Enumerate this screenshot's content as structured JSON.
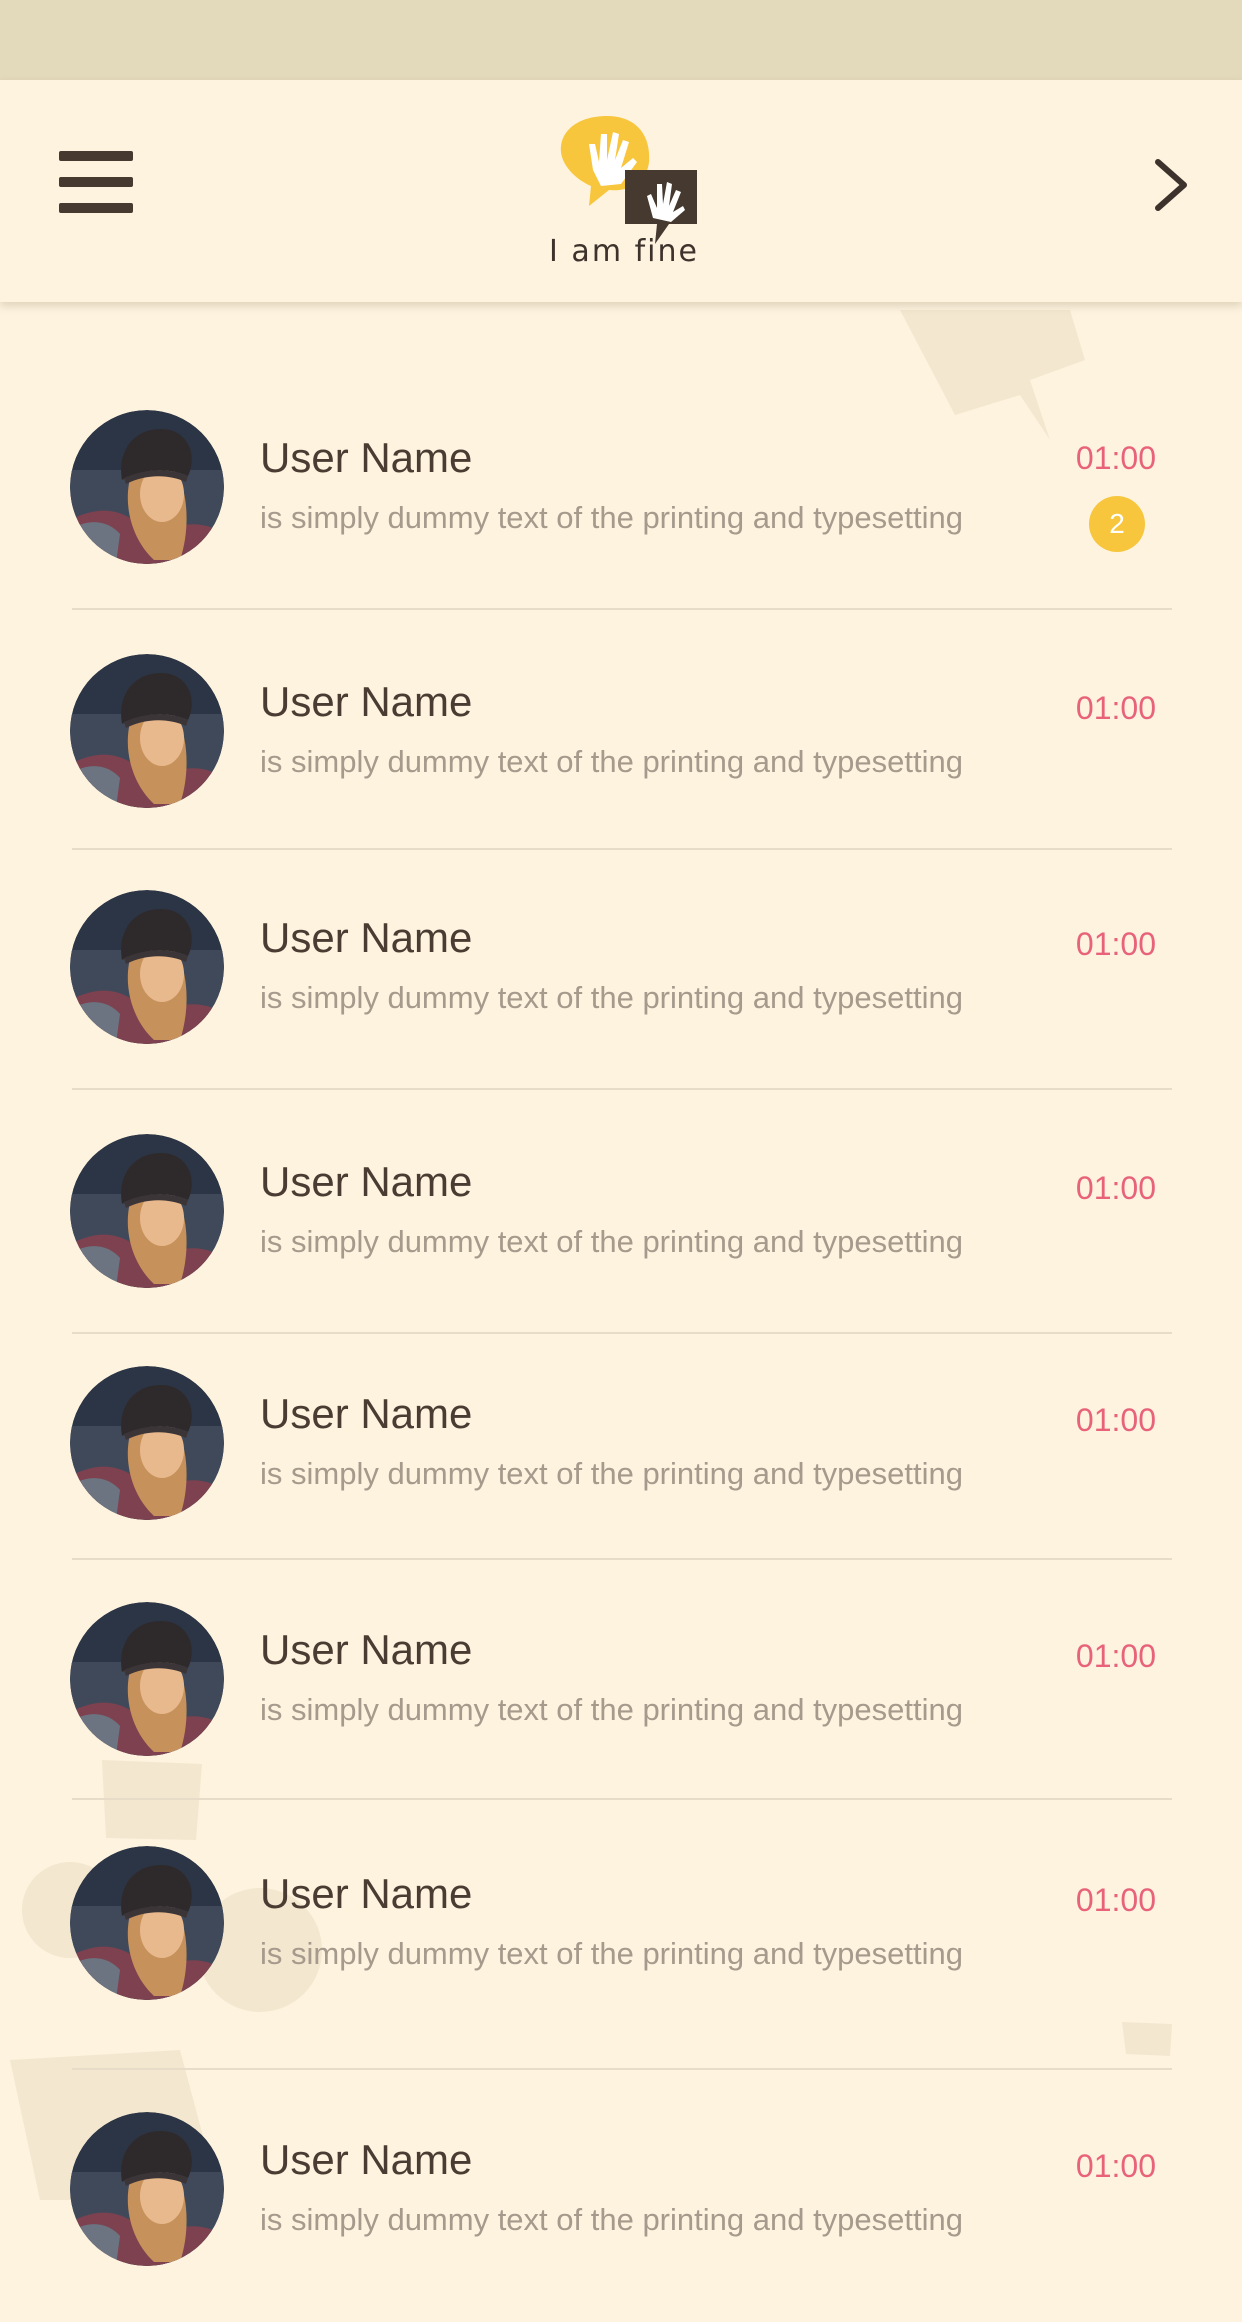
{
  "header": {
    "logo_text": "I am fine",
    "menu_icon": "hamburger-menu-icon",
    "back_icon": "chevron-right-icon"
  },
  "colors": {
    "background": "#fdf3df",
    "status_bar": "#e3d9bb",
    "logo_yellow": "#f7c63d",
    "logo_brown": "#46392f",
    "time_red": "#e8637a",
    "badge": "#f7c63d"
  },
  "conversations": [
    {
      "name": "User Name",
      "preview": "is simply dummy text of the printing and typesetting",
      "time": "01:00",
      "unread": "2"
    },
    {
      "name": "User Name",
      "preview": "is simply dummy text of the printing and typesetting",
      "time": "01:00"
    },
    {
      "name": "User Name",
      "preview": "is simply dummy text of the printing and typesetting",
      "time": "01:00"
    },
    {
      "name": "User Name",
      "preview": "is simply dummy text of the printing and typesetting",
      "time": "01:00"
    },
    {
      "name": "User Name",
      "preview": "is simply dummy text of the printing and typesetting",
      "time": "01:00"
    },
    {
      "name": "User Name",
      "preview": "is simply dummy text of the printing and typesetting",
      "time": "01:00"
    },
    {
      "name": "User Name",
      "preview": "is simply dummy text of the printing and typesetting",
      "time": "01:00"
    },
    {
      "name": "User Name",
      "preview": "is simply dummy text of the printing and typesetting",
      "time": "01:00"
    }
  ]
}
